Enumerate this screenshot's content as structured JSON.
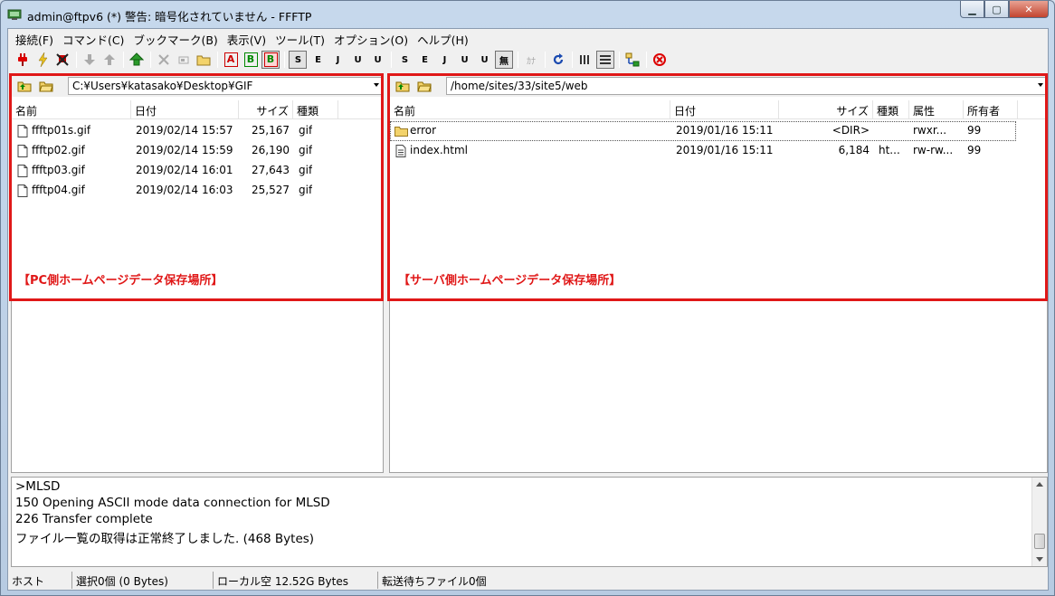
{
  "window": {
    "title": "admin@ftpv6 (*) 警告: 暗号化されていません - FFFTP",
    "minimize_glyph": "▁",
    "maximize_glyph": "▢",
    "close_glyph": "✕"
  },
  "menu": [
    "接続(F)",
    "コマンド(C)",
    "ブックマーク(B)",
    "表示(V)",
    "ツール(T)",
    "オプション(O)",
    "ヘルプ(H)"
  ],
  "toolbar": {
    "text_buttons": {
      "ascii": "A",
      "binary": "B",
      "auto": "B",
      "sjis_l": "S",
      "euc_l": "E",
      "jis_l": "J",
      "utf8n_l": "U",
      "utf8_l": "U",
      "sjis_r": "S",
      "euc_r": "E",
      "jis_r": "J",
      "utf8n_r": "U",
      "utf8_r": "U",
      "nochange": "無",
      "kana": "ｶﾅ"
    }
  },
  "local": {
    "path": "C:¥Users¥katasako¥Desktop¥GIF",
    "headers": [
      "名前",
      "日付",
      "サイズ",
      "種類"
    ],
    "files": [
      {
        "name": "ffftp01s.gif",
        "date": "2019/02/14 15:57",
        "size": "25,167",
        "type": "gif"
      },
      {
        "name": "ffftp02.gif",
        "date": "2019/02/14 15:59",
        "size": "26,190",
        "type": "gif"
      },
      {
        "name": "ffftp03.gif",
        "date": "2019/02/14 16:01",
        "size": "27,643",
        "type": "gif"
      },
      {
        "name": "ffftp04.gif",
        "date": "2019/02/14 16:03",
        "size": "25,527",
        "type": "gif"
      }
    ],
    "annotation": "【PC側ホームページデータ保存場所】"
  },
  "remote": {
    "path": "/home/sites/33/site5/web",
    "headers": [
      "名前",
      "日付",
      "サイズ",
      "種類",
      "属性",
      "所有者"
    ],
    "files": [
      {
        "name": "error",
        "date": "2019/01/16 15:11",
        "size": "<DIR>",
        "type": "",
        "attr": "rwxr...",
        "owner": "99"
      },
      {
        "name": "index.html",
        "date": "2019/01/16 15:11",
        "size": "6,184",
        "type": "ht...",
        "attr": "rw-rw...",
        "owner": "99"
      }
    ],
    "annotation": "【サーバ側ホームページデータ保存場所】"
  },
  "log": [
    ">MLSD",
    "150 Opening ASCII mode data connection for MLSD",
    "226 Transfer complete",
    "ファイル一覧の取得は正常終了しました. (468 Bytes)"
  ],
  "status": {
    "host": "ホスト",
    "selection": "選択0個 (0 Bytes)",
    "local_free": "ローカル空 12.52G Bytes",
    "queue": "転送待ちファイル0個"
  },
  "colors": {
    "annotation_red": "#e01818",
    "folder_yellow": "#f3d36b"
  }
}
